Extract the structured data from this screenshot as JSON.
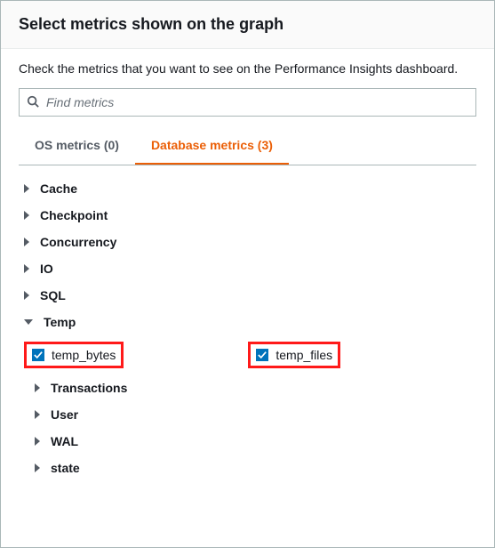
{
  "header": {
    "title": "Select metrics shown on the graph"
  },
  "instruction": "Check the metrics that you want to see on the Performance Insights dashboard.",
  "search": {
    "placeholder": "Find metrics"
  },
  "tabs": [
    {
      "label": "OS metrics (0)",
      "active": false
    },
    {
      "label": "Database metrics (3)",
      "active": true
    }
  ],
  "tree": {
    "groups_before": [
      "Cache",
      "Checkpoint",
      "Concurrency",
      "IO",
      "SQL"
    ],
    "expanded_group": {
      "label": "Temp",
      "items": [
        {
          "label": "temp_bytes",
          "checked": true
        },
        {
          "label": "temp_files",
          "checked": true
        }
      ]
    },
    "groups_after": [
      "Transactions",
      "User",
      "WAL",
      "state"
    ]
  }
}
